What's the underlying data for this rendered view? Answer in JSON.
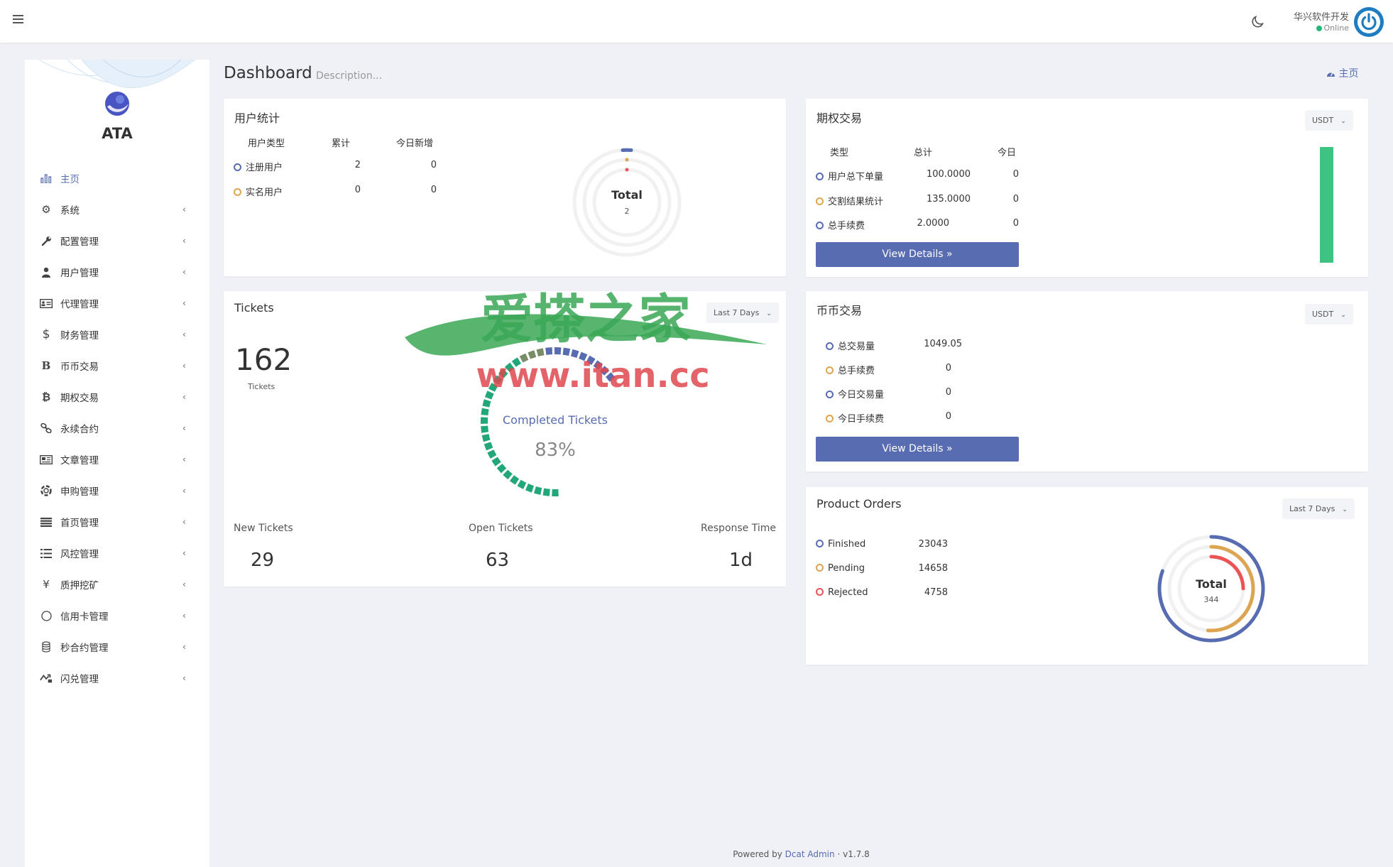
{
  "topbar": {
    "user_name": "华兴软件开发",
    "user_status": "Online"
  },
  "sidebar": {
    "brand": "ATA",
    "items": [
      {
        "label": "主页",
        "icon": "bar-chart-icon",
        "active": true
      },
      {
        "label": "系统",
        "icon": "gear-icon"
      },
      {
        "label": "配置管理",
        "icon": "wrench-icon"
      },
      {
        "label": "用户管理",
        "icon": "user-icon"
      },
      {
        "label": "代理管理",
        "icon": "id-card-icon"
      },
      {
        "label": "财务管理",
        "icon": "dollar-icon"
      },
      {
        "label": "币币交易",
        "icon": "b-letter-icon"
      },
      {
        "label": "期权交易",
        "icon": "bitcoin-icon"
      },
      {
        "label": "永续合约",
        "icon": "link-icon"
      },
      {
        "label": "文章管理",
        "icon": "newspaper-icon"
      },
      {
        "label": "申购管理",
        "icon": "lifebuoy-icon"
      },
      {
        "label": "首页管理",
        "icon": "list-icon"
      },
      {
        "label": "风控管理",
        "icon": "list-alt-icon"
      },
      {
        "label": "质押挖矿",
        "icon": "yen-icon"
      },
      {
        "label": "信用卡管理",
        "icon": "circle-icon"
      },
      {
        "label": "秒合约管理",
        "icon": "coins-icon"
      },
      {
        "label": "闪兑管理",
        "icon": "exchange-icon"
      }
    ]
  },
  "header": {
    "title": "Dashboard",
    "description": "Description...",
    "breadcrumb": "主页"
  },
  "user_stats": {
    "title": "用户统计",
    "headers": [
      "用户类型",
      "累计",
      "今日新增"
    ],
    "rows": [
      {
        "type": "注册用户",
        "total": "2",
        "today": "0"
      },
      {
        "type": "实名用户",
        "total": "0",
        "today": "0"
      }
    ],
    "donut_label": "Total",
    "donut_value": "2"
  },
  "options_trading": {
    "title": "期权交易",
    "currency": "USDT",
    "headers": [
      "类型",
      "总计",
      "今日"
    ],
    "rows": [
      {
        "type": "用户总下单量",
        "total": "100.0000",
        "today": "0"
      },
      {
        "type": "交割结果统计",
        "total": "135.0000",
        "today": "0"
      },
      {
        "type": "总手续费",
        "total": "2.0000",
        "today": "0"
      }
    ],
    "button": "View Details »"
  },
  "tickets": {
    "title": "Tickets",
    "period": "Last 7 Days",
    "count": "162",
    "count_label": "Tickets",
    "gauge_label": "Completed Tickets",
    "gauge_value": "83%",
    "gauge_fraction": 0.83,
    "stats": [
      {
        "label": "New Tickets",
        "value": "29"
      },
      {
        "label": "Open Tickets",
        "value": "63"
      },
      {
        "label": "Response Time",
        "value": "1d"
      }
    ]
  },
  "coin_trading": {
    "title": "币币交易",
    "currency": "USDT",
    "rows": [
      {
        "type": "总交易量",
        "value": "1049.05"
      },
      {
        "type": "总手续费",
        "value": "0"
      },
      {
        "type": "今日交易量",
        "value": "0"
      },
      {
        "type": "今日手续费",
        "value": "0"
      }
    ],
    "button": "View Details »"
  },
  "product_orders": {
    "title": "Product Orders",
    "period": "Last 7 Days",
    "rows": [
      {
        "label": "Finished",
        "value": "23043"
      },
      {
        "label": "Pending",
        "value": "14658"
      },
      {
        "label": "Rejected",
        "value": "4758"
      }
    ],
    "donut_label": "Total",
    "donut_value": "344"
  },
  "footer": {
    "prefix": "Powered by",
    "link": "Dcat Admin",
    "sep": "·",
    "version": "v1.7.8"
  },
  "watermark": {
    "title": "爱搽之家",
    "url": "www.itan.cc"
  },
  "colors": {
    "primary": "#586cb1",
    "success": "#21b978",
    "warning": "#dda451",
    "danger": "#ea5455"
  }
}
